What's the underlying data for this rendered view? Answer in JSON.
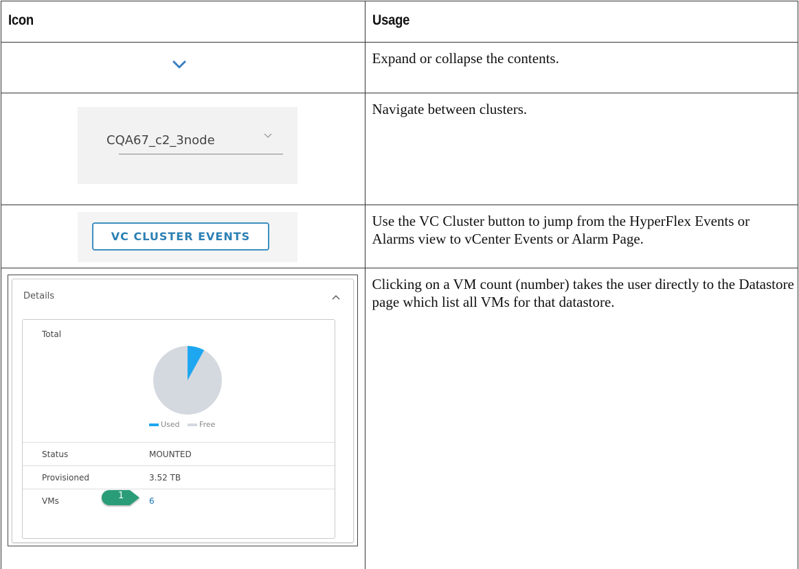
{
  "table": {
    "headers": {
      "icon": "Icon",
      "usage": "Usage"
    },
    "rows": [
      {
        "usage": "Expand or collapse the contents."
      },
      {
        "usage": "Navigate between clusters."
      },
      {
        "usage": "Use the VC Cluster button to jump from the HyperFlex Events or Alarms view to vCenter Events or Alarm Page."
      },
      {
        "usage": "Clicking on a VM count (number) takes the user directly to the Datastore page which list all VMs for that datastore."
      }
    ]
  },
  "cluster_selector": {
    "value": "CQA67_c2_3node"
  },
  "vc_button": {
    "label": "VC CLUSTER EVENTS"
  },
  "details_panel": {
    "title": "Details",
    "total_label": "Total",
    "legend": {
      "used": "Used",
      "free": "Free"
    },
    "usage_fraction": 0.08,
    "status_label": "Status",
    "status_value": "MOUNTED",
    "provisioned_label": "Provisioned",
    "provisioned_value": "3.52 TB",
    "vms_label": "VMs",
    "vms_value": "6",
    "callout_number": "1"
  },
  "colors": {
    "used": "#1ea7f0",
    "free": "#d4d8df",
    "callout": "#2a9d78",
    "button": "#3b8fc1"
  }
}
